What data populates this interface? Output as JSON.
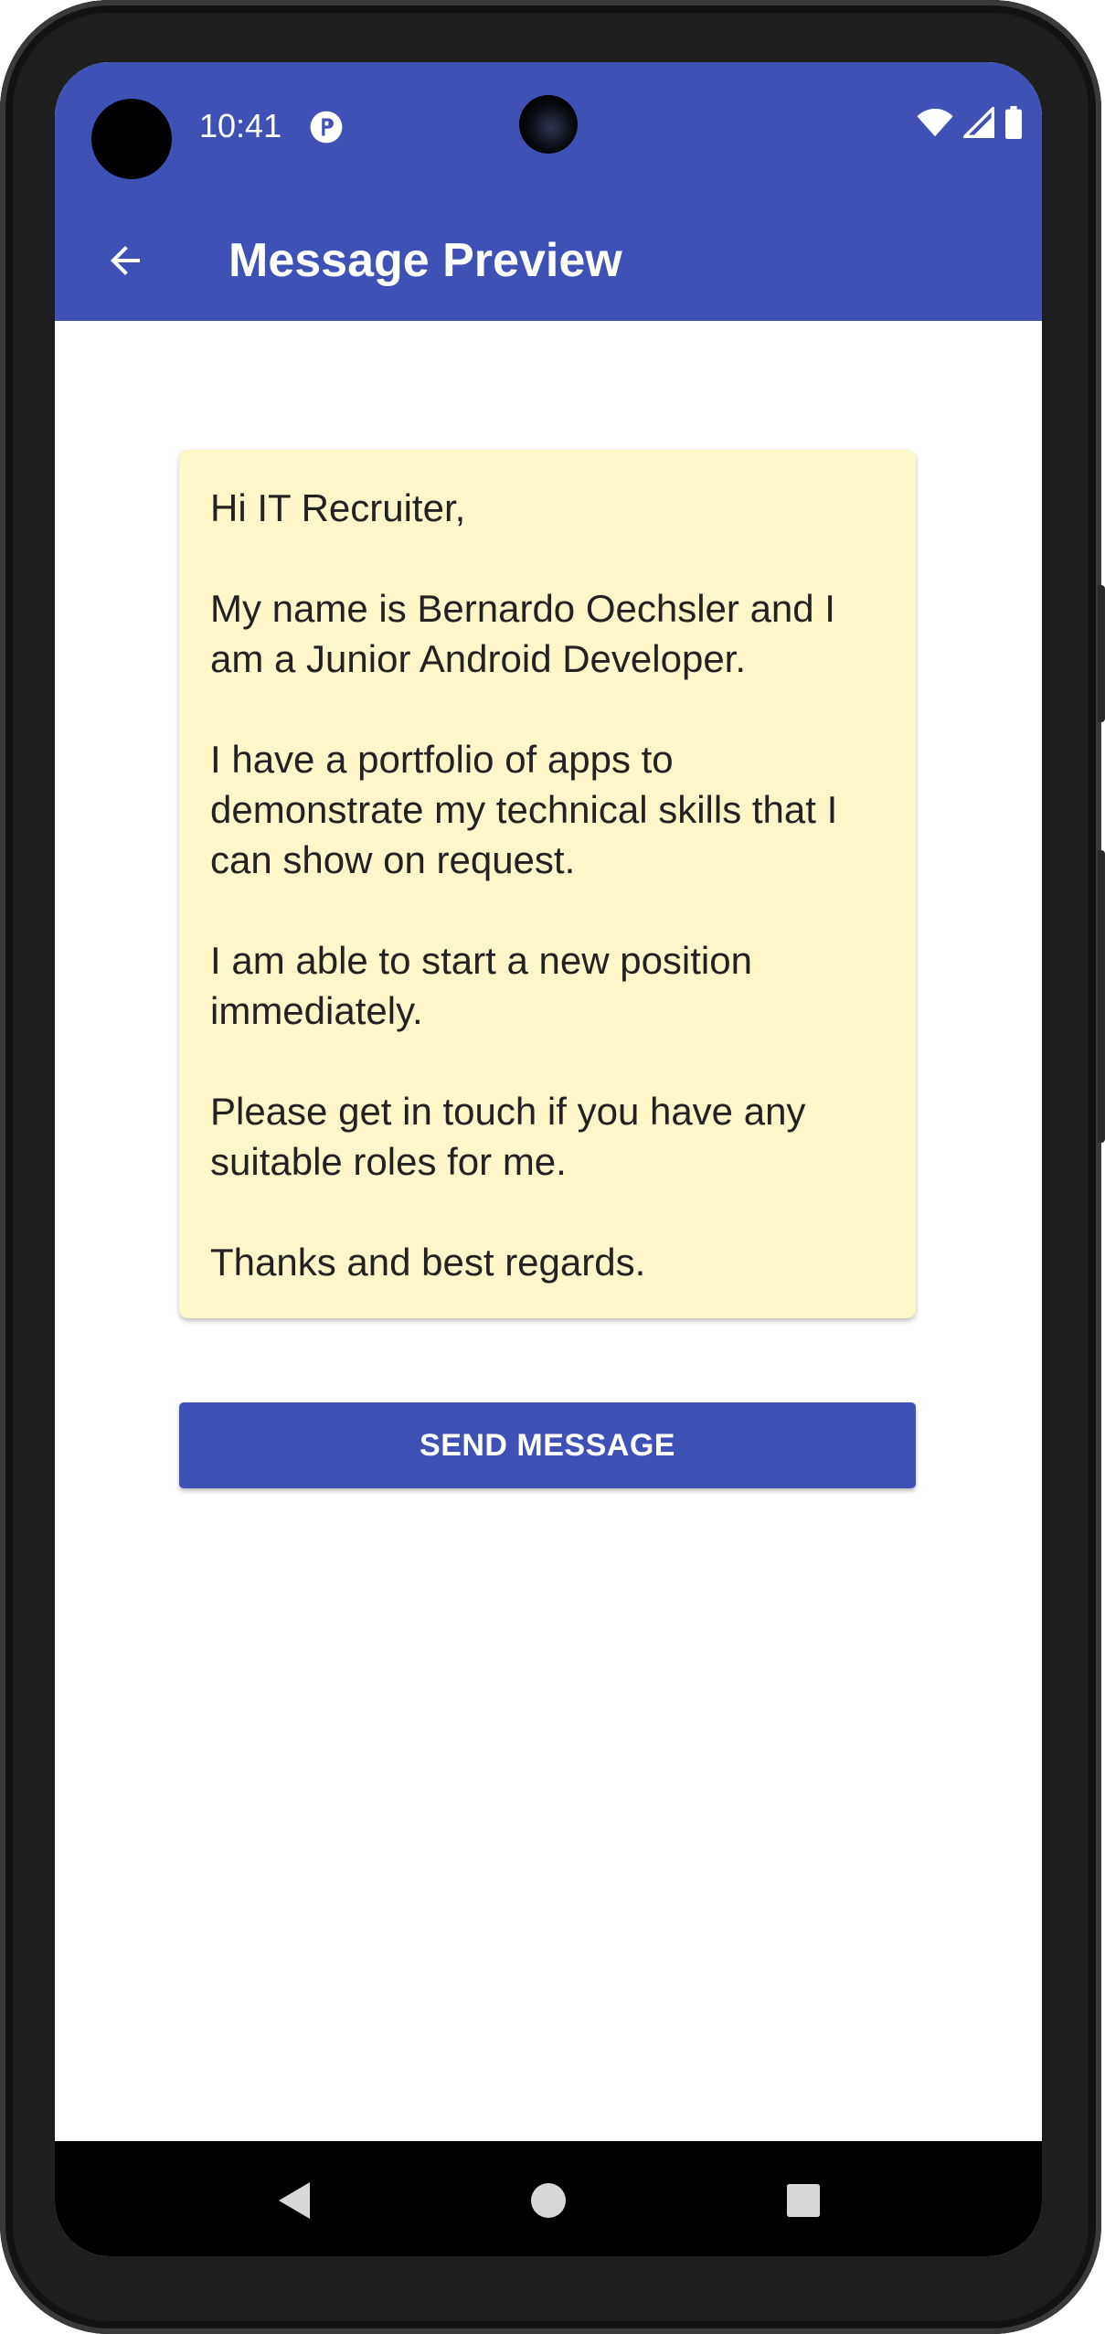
{
  "status_bar": {
    "time": "10:41",
    "icons": [
      "notification-app-icon",
      "wifi-icon",
      "signal-icon",
      "battery-icon"
    ]
  },
  "toolbar": {
    "back_icon": "arrow-back-icon",
    "title": "Message Preview"
  },
  "message_card": {
    "text": "Hi IT Recruiter,\n\nMy name is Bernardo Oechsler and I am a Junior Android Developer.\n\nI have a portfolio of apps to demonstrate my technical skills that I can show on request.\n\nI am able to start a new position immediately.\n\nPlease get in touch if you have any suitable roles for me.\n\nThanks and best regards."
  },
  "actions": {
    "send_label": "SEND MESSAGE"
  },
  "nav_bar": {
    "icons": [
      "back-triangle-icon",
      "home-circle-icon",
      "recents-square-icon"
    ]
  },
  "colors": {
    "primary": "#3f51b5",
    "card_background": "#fdf6c9",
    "nav_bar": "#000000"
  }
}
